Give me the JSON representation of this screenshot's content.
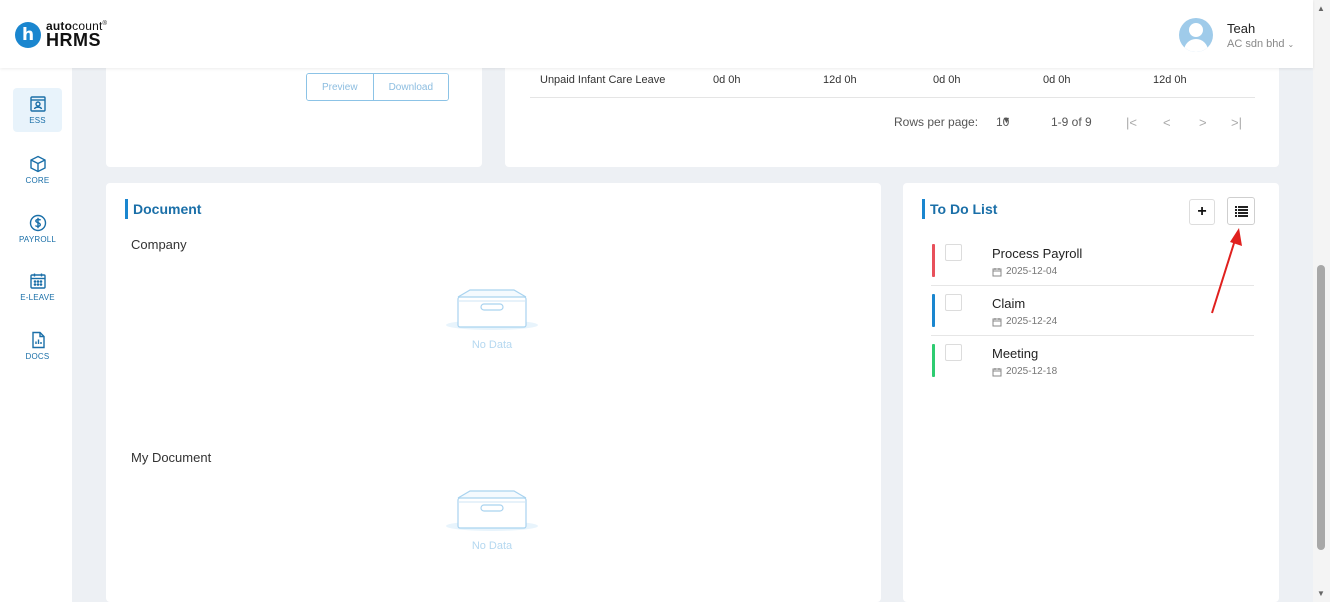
{
  "brand": {
    "name_prefix": "auto",
    "name_suffix": "count",
    "trademark": "®",
    "product": "HRMS",
    "logo_letter": "h"
  },
  "user": {
    "name": "Teah",
    "company": "AC sdn bhd"
  },
  "sidebar": {
    "items": [
      {
        "label": "ESS",
        "icon": "ess-icon",
        "active": true
      },
      {
        "label": "CORE",
        "icon": "cube-icon",
        "active": false
      },
      {
        "label": "PAYROLL",
        "icon": "dollar-icon",
        "active": false
      },
      {
        "label": "E-LEAVE",
        "icon": "calendar-icon",
        "active": false
      },
      {
        "label": "DOCS",
        "icon": "document-icon",
        "active": false
      }
    ]
  },
  "payslip_card": {
    "preview_label": "Preview",
    "download_label": "Download"
  },
  "leave_table": {
    "row": [
      "Unpaid Infant Care Leave",
      "0d 0h",
      "12d 0h",
      "0d 0h",
      "0d 0h",
      "12d 0h"
    ],
    "pagination": {
      "rows_per_page_label": "Rows per page:",
      "rows_per_page": "10",
      "range": "1-9 of 9"
    }
  },
  "document": {
    "title": "Document",
    "sections": [
      {
        "label": "Company",
        "empty_text": "No Data"
      },
      {
        "label": "My Document",
        "empty_text": "No Data"
      }
    ]
  },
  "todo": {
    "title": "To Do List",
    "add_label": "+",
    "items": [
      {
        "name": "Process Payroll",
        "date": "2025-12-04",
        "color": "#e8505b"
      },
      {
        "name": "Claim",
        "date": "2025-12-24",
        "color": "#1a86cf"
      },
      {
        "name": "Meeting",
        "date": "2025-12-18",
        "color": "#2ecc71"
      }
    ]
  },
  "colors": {
    "accent": "#1a86cf",
    "annotation_arrow": "#e0201e"
  }
}
